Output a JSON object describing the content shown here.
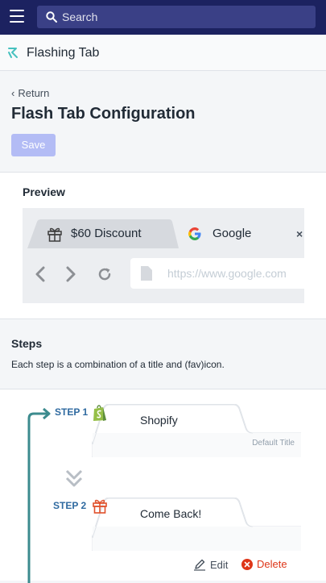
{
  "topbar": {
    "search_placeholder": "Search",
    "menu_icon": "hamburger-menu-icon",
    "search_icon": "search-icon",
    "background_color": "#1c2260"
  },
  "app": {
    "name": "Flashing Tab",
    "logo_icon": "flashing-tab-logo-icon"
  },
  "page": {
    "back_label": "Return",
    "title": "Flash Tab Configuration",
    "save_label": "Save",
    "save_color": "#b3bcf5"
  },
  "preview": {
    "heading": "Preview",
    "tabs": [
      {
        "label": "$60 Discount",
        "icon": "gift-icon",
        "active": true
      },
      {
        "label": "Google",
        "icon": "google-icon",
        "active": false
      }
    ],
    "close_glyph": "×",
    "url_placeholder": "https://www.google.com"
  },
  "steps": {
    "heading": "Steps",
    "description": "Each step is a combination of a title and (fav)icon.",
    "accent_color": "#2f6aa0",
    "items": [
      {
        "label": "STEP 1",
        "title": "Shopify",
        "icon": "shopify-icon",
        "note": "Default Title"
      },
      {
        "label": "STEP 2",
        "title": "Come Back!",
        "icon": "gift-icon"
      }
    ],
    "edit_label": "Edit",
    "delete_label": "Delete",
    "delete_color": "#de3618"
  }
}
